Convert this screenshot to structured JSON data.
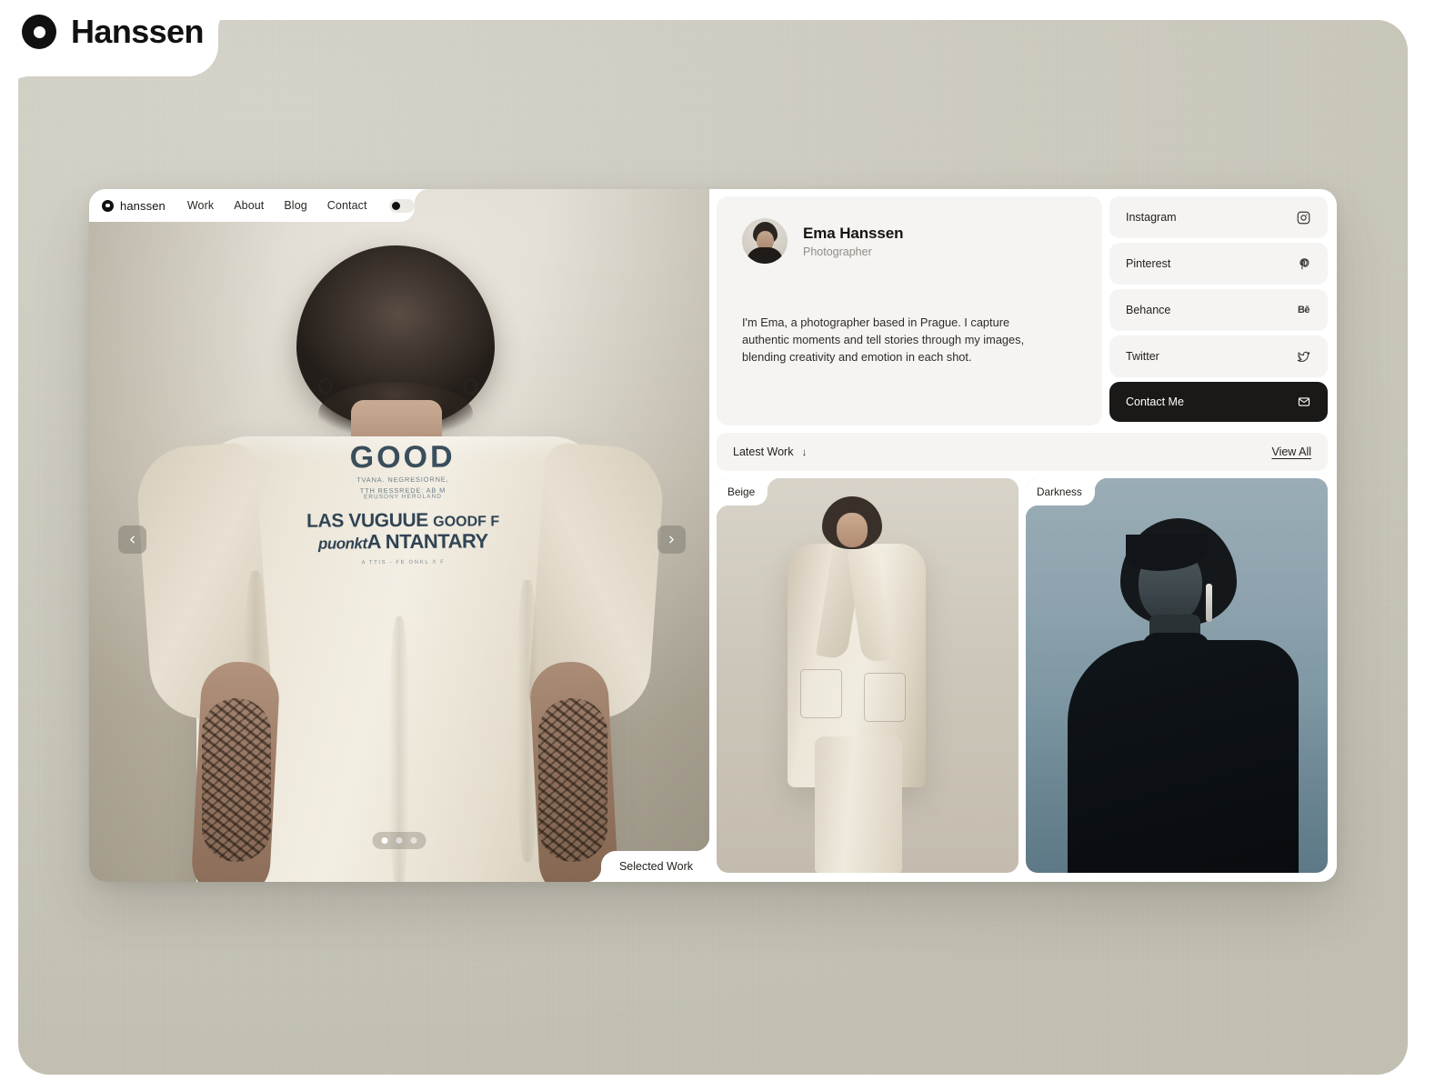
{
  "brand": {
    "name": "Hanssen",
    "mark_icon": "ring-logo-icon"
  },
  "site_nav": {
    "brand_label": "hanssen",
    "brand_mark_icon": "ring-logo-icon",
    "links": [
      {
        "label": "Work"
      },
      {
        "label": "About"
      },
      {
        "label": "Blog"
      },
      {
        "label": "Contact"
      }
    ],
    "theme_toggle": {
      "icon": "theme-toggle-icon",
      "state": "light"
    }
  },
  "hero": {
    "corner_label": "Selected Work",
    "prev_icon": "chevron-left-icon",
    "next_icon": "chevron-right-icon",
    "slides_total": 3,
    "active_slide": 1,
    "shirt_graphic": {
      "headline": "GOOD",
      "sub_line_1": "TVANA. NEGRESIORNE,",
      "sub_line_2": "TTH RESSREDE: AB M",
      "line_2_main": "LAS VUGUUE",
      "line_2_small": "GOODF F",
      "line_2_tiny": "ERUSONY HEROLAND",
      "line_3_italic": "puonkt",
      "line_3_main": "A NTANTARY",
      "footer": "A TTIS  -  FE  ONKL X F"
    }
  },
  "profile": {
    "name": "Ema Hanssen",
    "role": "Photographer",
    "avatar_icon": "avatar-photo",
    "bio": "I'm Ema, a photographer based in Prague. I capture authentic moments and tell stories through my images, blending creativity and emotion in each shot."
  },
  "socials": [
    {
      "label": "Instagram",
      "icon": "instagram-icon",
      "style": "light"
    },
    {
      "label": "Pinterest",
      "icon": "pinterest-icon",
      "style": "light"
    },
    {
      "label": "Behance",
      "icon": "behance-icon",
      "style": "light"
    },
    {
      "label": "Twitter",
      "icon": "twitter-icon",
      "style": "light"
    },
    {
      "label": "Contact Me",
      "icon": "mail-icon",
      "style": "dark"
    }
  ],
  "latest_work": {
    "title": "Latest Work",
    "title_arrow_icon": "arrow-down-icon",
    "view_all_label": "View All",
    "items": [
      {
        "label": "Beige"
      },
      {
        "label": "Darkness"
      }
    ]
  },
  "colors": {
    "backdrop": "#cecbc0",
    "surface": "#ffffff",
    "card": "#f5f4f2",
    "ink": "#141310",
    "muted": "#8f8c86",
    "accent_dark": "#1b1917"
  }
}
